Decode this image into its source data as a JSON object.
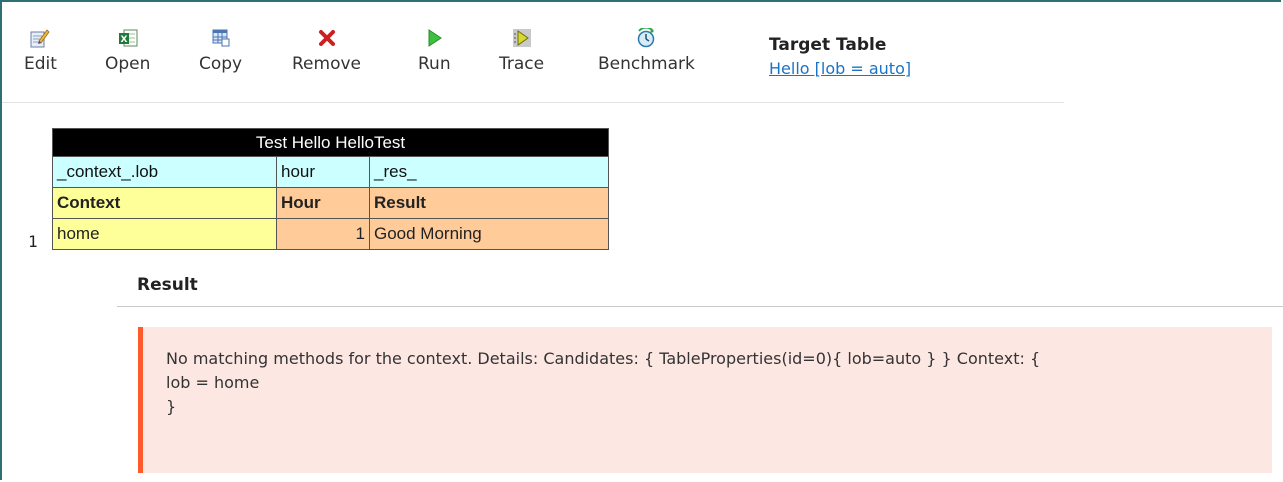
{
  "toolbar": {
    "buttons": [
      {
        "id": "edit",
        "label": "Edit",
        "icon": "edit-icon"
      },
      {
        "id": "open",
        "label": "Open",
        "icon": "excel-icon"
      },
      {
        "id": "copy",
        "label": "Copy",
        "icon": "table-copy-icon"
      },
      {
        "id": "remove",
        "label": "Remove",
        "icon": "remove-icon"
      },
      {
        "id": "run",
        "label": "Run",
        "icon": "play-icon"
      },
      {
        "id": "trace",
        "label": "Trace",
        "icon": "trace-icon"
      },
      {
        "id": "benchmark",
        "label": "Benchmark",
        "icon": "benchmark-icon"
      }
    ]
  },
  "target": {
    "title": "Target Table",
    "link": "Hello [lob = auto]"
  },
  "test_table": {
    "header": "Test Hello HelloTest",
    "tech_columns": [
      "_context_.lob",
      "hour",
      "_res_"
    ],
    "display_columns": [
      "Context",
      "Hour",
      "Result"
    ],
    "rows": [
      {
        "num": "1",
        "context": "home",
        "hour": "1",
        "result": "Good Morning"
      }
    ]
  },
  "result": {
    "title": "Result",
    "error_lines": [
      "No matching methods for the context. Details: Candidates: { TableProperties(id=0){ lob=auto } } Context: {",
      "lob = home",
      "}"
    ]
  },
  "colors": {
    "header_bg": "#000000",
    "tech_row_bg": "#ccffff",
    "context_bg": "#ffff99",
    "result_bg": "#ffcc99",
    "error_bg": "#fde7e3",
    "error_border": "#ff5a2b",
    "link": "#1a73c9"
  }
}
